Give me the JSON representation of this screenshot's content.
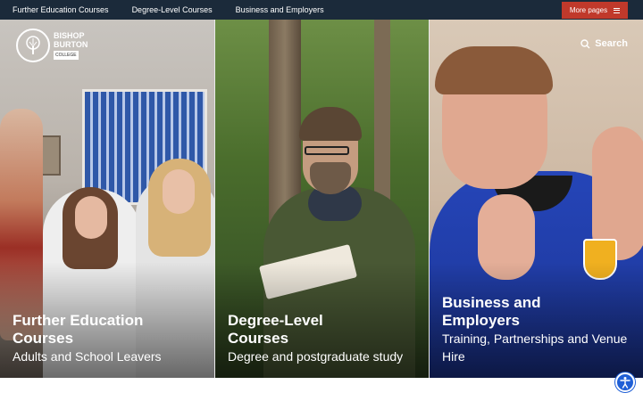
{
  "top_nav": {
    "links": [
      "Further Education Courses",
      "Degree-Level Courses",
      "Business and Employers"
    ],
    "more_pages_label": "More pages"
  },
  "logo": {
    "line1": "BISHOP",
    "line2": "BURTON",
    "line3": "COLLEGE"
  },
  "search": {
    "label": "Search"
  },
  "panels": [
    {
      "title_line1": "Further Education",
      "title_line2": "Courses",
      "subtitle": "Adults and School Leavers"
    },
    {
      "title_line1": "Degree-Level",
      "title_line2": "Courses",
      "subtitle": "Degree and postgraduate study"
    },
    {
      "title_line1": "Business and",
      "title_line2": "Employers",
      "subtitle": "Training, Partnerships and Venue Hire"
    }
  ],
  "colors": {
    "top_bar": "#1b2a3a",
    "more_pages_button": "#c0392b",
    "accessibility_button": "#1f5fd6"
  },
  "icons": {
    "more_pages": "hamburger-icon",
    "search": "search-icon",
    "accessibility": "accessibility-icon",
    "logo": "tree-logo-icon"
  }
}
